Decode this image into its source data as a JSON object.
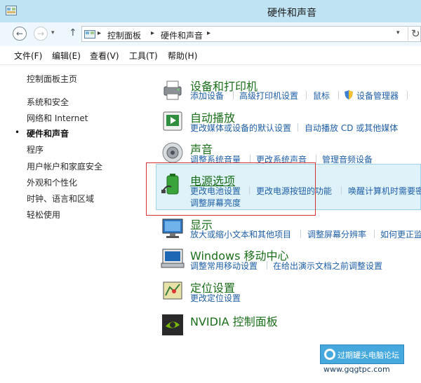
{
  "window": {
    "title": "硬件和声音"
  },
  "address_bar": {
    "crumbs": [
      "控制面板",
      "硬件和声音"
    ],
    "refresh_glyph": "↻",
    "back_glyph": "←",
    "forward_glyph": "→",
    "up_glyph": "↑",
    "dropdown_glyph": "▾"
  },
  "menu": {
    "items": [
      "文件(F)",
      "编辑(E)",
      "查看(V)",
      "工具(T)",
      "帮助(H)"
    ]
  },
  "sidebar": {
    "home": "控制面板主页",
    "items": [
      "系统和安全",
      "网络和 Internet",
      "硬件和声音",
      "程序",
      "用户帐户和家庭安全",
      "外观和个性化",
      "时钟、语言和区域",
      "轻松使用"
    ],
    "current_index": 2,
    "bullet": "•"
  },
  "categories": [
    {
      "title": "设备和打印机",
      "icon": "printer-icon",
      "links": [
        "添加设备",
        "高级打印机设置",
        "鼠标",
        "设备管理器"
      ]
    },
    {
      "title": "自动播放",
      "icon": "autoplay-icon",
      "links": [
        "更改媒体或设备的默认设置",
        "自动播放 CD 或其他媒体"
      ]
    },
    {
      "title": "声音",
      "icon": "speaker-icon",
      "links": [
        "调整系统音量",
        "更改系统声音",
        "管理音频设备"
      ]
    },
    {
      "title": "电源选项",
      "icon": "battery-icon",
      "links": [
        "更改电池设置",
        "更改电源按钮的功能",
        "唤醒计算机时需要密",
        "调整屏幕亮度"
      ]
    },
    {
      "title": "显示",
      "icon": "display-icon",
      "links": [
        "放大或缩小文本和其他项目",
        "调整屏幕分辨率",
        "如何更正监视"
      ]
    },
    {
      "title": "Windows 移动中心",
      "icon": "mobility-center-icon",
      "links": [
        "调整常用移动设置",
        "在给出演示文档之前调整设置"
      ]
    },
    {
      "title": "定位设置",
      "icon": "location-icon",
      "links": [
        "更改定位设置"
      ]
    },
    {
      "title": "NVIDIA 控制面板",
      "icon": "nvidia-icon",
      "links": []
    }
  ],
  "watermark": {
    "text": "过期罐头电脑论坛",
    "url": "www.gqgtpc.com"
  },
  "colors": {
    "title_bar": "#bfe3f2",
    "category_title": "#1a6e1a",
    "link": "#1f5fa7",
    "highlight": "#dff1f9",
    "annotation_red": "#d53131"
  }
}
